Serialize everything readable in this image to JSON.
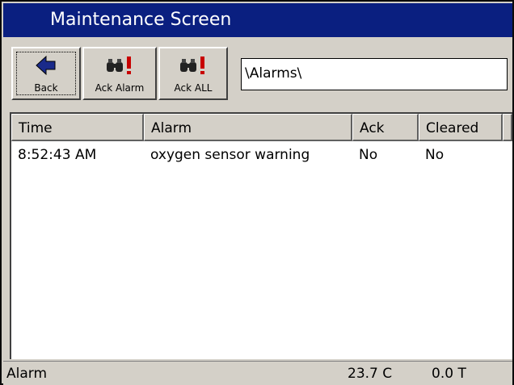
{
  "window": {
    "title": "Maintenance Screen"
  },
  "toolbar": {
    "back_label": "Back",
    "back_icon": "arrow-left-icon",
    "ack_alarm_label": "Ack Alarm",
    "ack_all_label": "Ack ALL",
    "ack_icon": "binoculars-alert-icon",
    "path_value": "\\Alarms\\"
  },
  "table": {
    "columns": [
      "Time",
      "Alarm",
      "Ack",
      "Cleared"
    ],
    "rows": [
      {
        "time": "8:52:43 AM",
        "alarm": "oxygen sensor warning",
        "ack": "No",
        "cleared": "No"
      }
    ]
  },
  "status": {
    "mode": "Alarm",
    "temperature": "23.7 C",
    "field": "0.0 T"
  },
  "colors": {
    "titlebar": "#0a1f80",
    "window_bg": "#d4d0c8",
    "alert_red": "#c80000",
    "back_arrow": "#1a2a8a"
  }
}
